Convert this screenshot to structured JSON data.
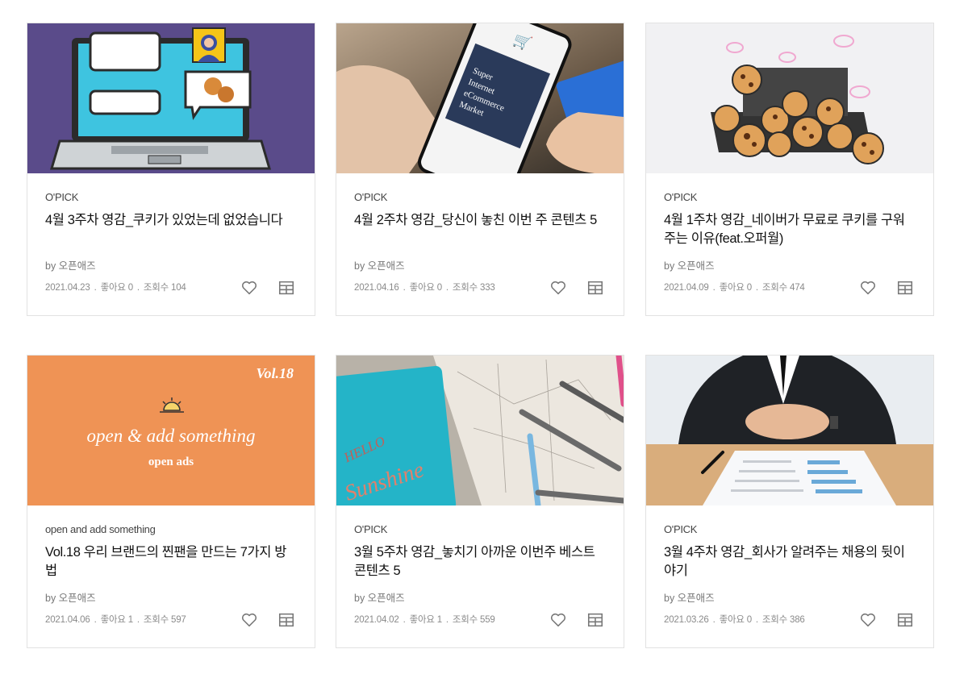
{
  "cards": [
    {
      "category": "O'PICK",
      "title": "4월 3주차 영감_쿠키가 있었는데 없었습니다",
      "author": "by 오픈애즈",
      "date": "2021.04.23",
      "likes": "좋아요 0",
      "views": "조회수 104",
      "image": "laptop-chat-cookie-illustration"
    },
    {
      "category": "O'PICK",
      "title": "4월 2주차 영감_당신이 놓친 이번 주 콘텐츠 5",
      "author": "by 오픈애즈",
      "date": "2021.04.16",
      "likes": "좋아요 0",
      "views": "조회수 333",
      "image": "phone-shopping-card-photo",
      "image_text": [
        "Super",
        "Internet",
        "eCommerce",
        "Market"
      ]
    },
    {
      "category": "O'PICK",
      "title": "4월 1주차 영감_네이버가 무료로 쿠키를 구워주는 이유(feat.오퍼월)",
      "author": "by 오픈애즈",
      "date": "2021.04.09",
      "likes": "좋아요 0",
      "views": "조회수 474",
      "image": "cookie-tray-illustration"
    },
    {
      "category": "open and add something",
      "title": "Vol.18 우리 브랜드의 찐팬을 만드는 7가지 방법",
      "author": "by 오픈애즈",
      "date": "2021.04.06",
      "likes": "좋아요 1",
      "views": "조회수 597",
      "image": "open-ads-banner",
      "image_text": [
        "Vol.18",
        "open & add something",
        "open ads"
      ]
    },
    {
      "category": "O'PICK",
      "title": "3월 5주차 영감_놓치기 아까운 이번주 베스트 콘텐츠 5",
      "author": "by 오픈애즈",
      "date": "2021.04.02",
      "likes": "좋아요 1",
      "views": "조회수 559",
      "image": "notebook-pencils-photo",
      "image_text": [
        "HELLO",
        "Sunshine"
      ]
    },
    {
      "category": "O'PICK",
      "title": "3월 4주차 영감_회사가 알려주는 채용의 뒷이야기",
      "author": "by 오픈애즈",
      "date": "2021.03.26",
      "likes": "좋아요 0",
      "views": "조회수 386",
      "image": "interview-resume-photo"
    }
  ],
  "icons": {
    "like": "heart-icon",
    "save": "bookmark-grid-icon"
  },
  "colors": {
    "purple_bg": "#5a4b8a",
    "orange_bg": "#ef9355",
    "border": "#e2e2e2"
  }
}
